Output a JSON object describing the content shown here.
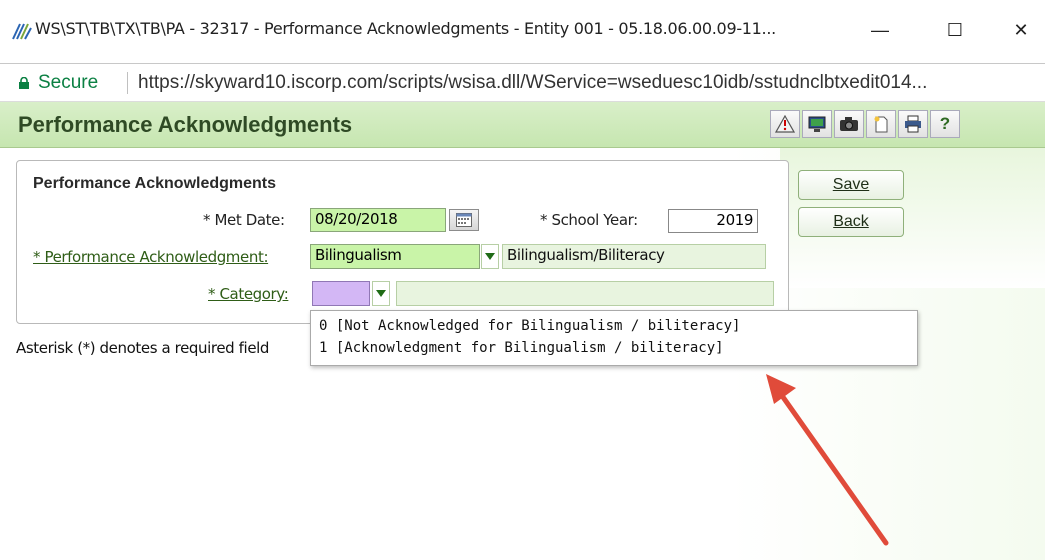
{
  "window": {
    "title": "WS\\ST\\TB\\TX\\TB\\PA - 32317 - Performance Acknowledgments - Entity 001 - 05.18.06.00.09-11...",
    "minimize_glyph": "—",
    "maximize_glyph": "☐",
    "close_glyph": "✕"
  },
  "address_bar": {
    "secure_label": "Secure",
    "url": "https://skyward10.iscorp.com/scripts/wsisa.dll/WService=wseduesc10idb/sstudnclbtxedit014..."
  },
  "header": {
    "title": "Performance Acknowledgments",
    "toolbar_icons": [
      "alert-icon",
      "monitor-icon",
      "camera-icon",
      "new-document-icon",
      "print-icon",
      "help-icon"
    ],
    "help_glyph": "?"
  },
  "form": {
    "panel_title": "Performance Acknowledgments",
    "met_date_label": "* Met Date:",
    "met_date_value": "08/20/2018",
    "school_year_label": "* School Year:",
    "school_year_value": "2019",
    "performance_ack_label": "* Performance Acknowledgment:",
    "performance_ack_value": "Bilingualism",
    "performance_ack_desc": "Bilingualism/Biliteracy",
    "category_label": "* Category:",
    "category_value": "",
    "category_desc": ""
  },
  "buttons": {
    "save": "Save",
    "back": "Back"
  },
  "note": "Asterisk (*) denotes a required field",
  "dropdown": {
    "options": [
      "0 [Not Acknowledged for Bilingualism / biliteracy]",
      "1 [Acknowledgment for Bilingualism / biliteracy]"
    ]
  },
  "colors": {
    "header_green": "#c6e6b0",
    "field_green": "#c9f4a8",
    "category_field": "#d3b7f5",
    "annotation_arrow": "#e04b3a",
    "secure_green": "#0b8043"
  }
}
